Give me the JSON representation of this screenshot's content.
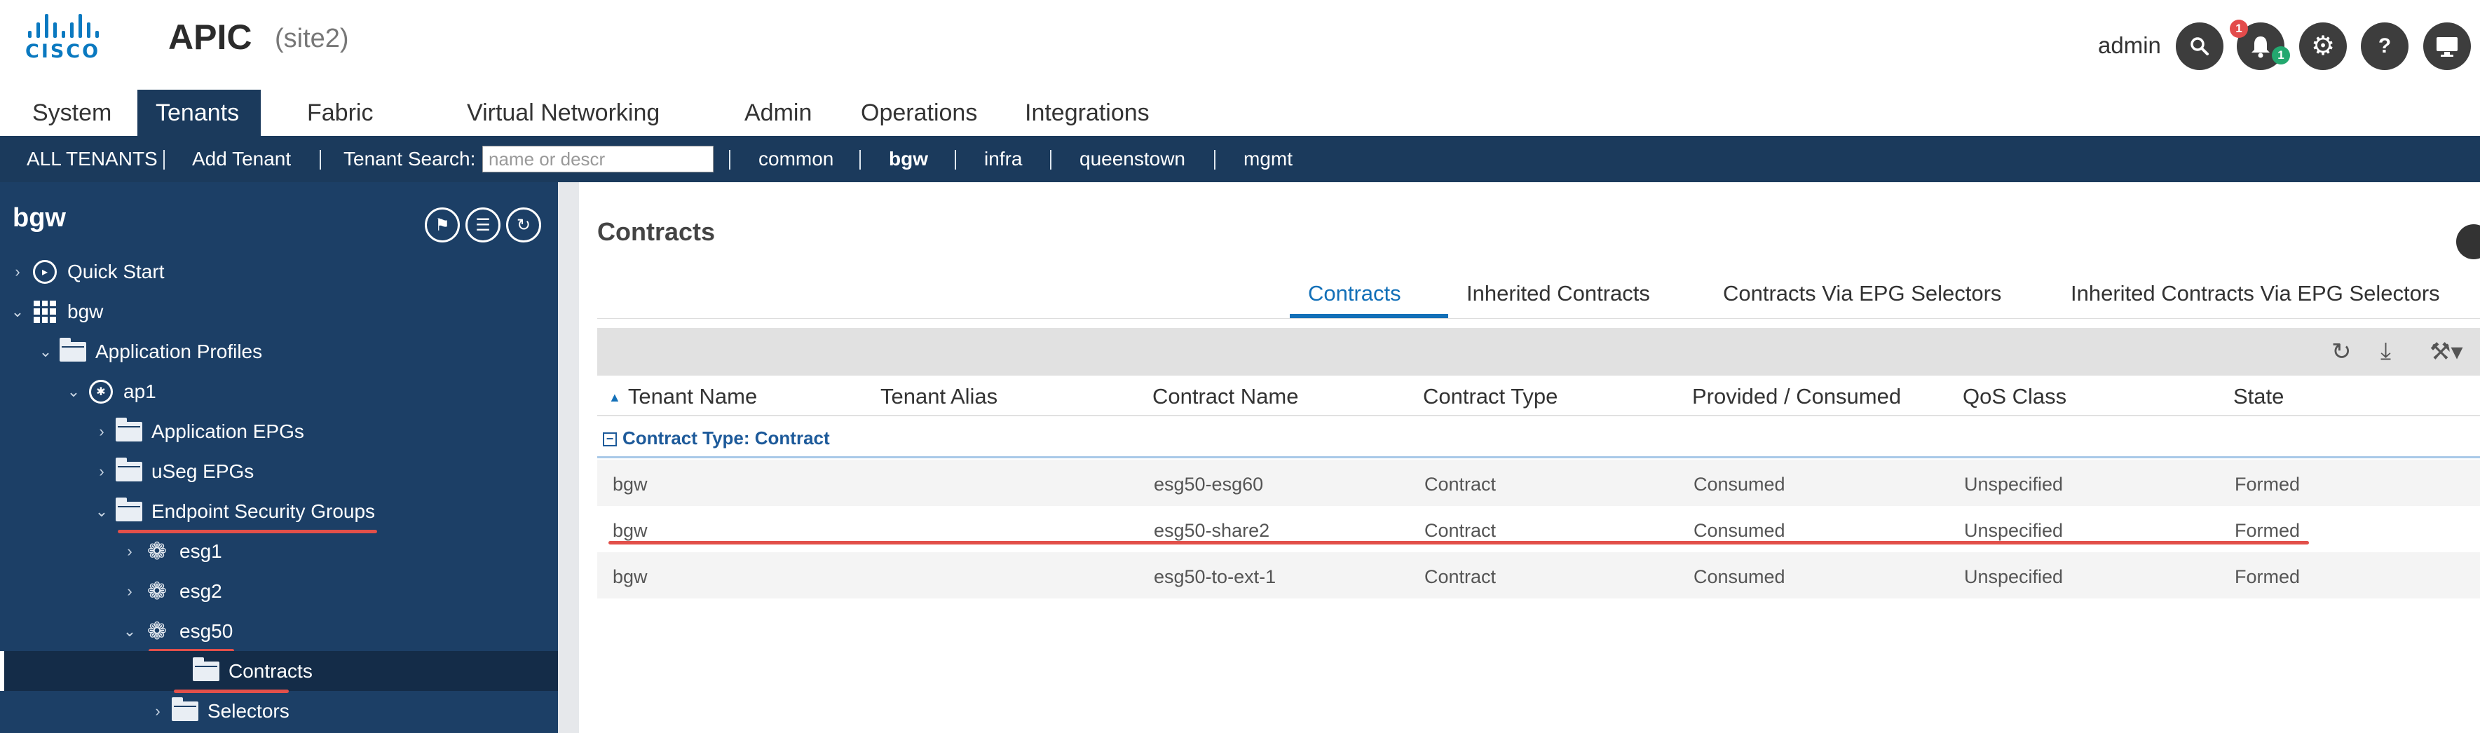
{
  "header": {
    "logo_text": "CISCO",
    "app_name": "APIC",
    "site": "(site2)",
    "user": "admin",
    "alert_badge": "1",
    "faults_badge": "1",
    "help_label": "?"
  },
  "nav": {
    "tabs": [
      "System",
      "Tenants",
      "Fabric",
      "Virtual Networking",
      "Admin",
      "Operations",
      "Integrations"
    ],
    "active": "Tenants"
  },
  "subbar": {
    "all_tenants": "ALL TENANTS",
    "add_tenant": "Add Tenant",
    "search_label": "Tenant Search:",
    "search_placeholder": "name or descr",
    "tenants": [
      "common",
      "bgw",
      "infra",
      "queenstown",
      "mgmt"
    ],
    "current": "bgw"
  },
  "sidebar": {
    "title": "bgw",
    "tree": [
      {
        "label": "Quick Start",
        "icon": "quick-start-icon"
      },
      {
        "label": "bgw",
        "icon": "tenant-grid-icon"
      },
      {
        "label": "Application Profiles",
        "icon": "folder-icon"
      },
      {
        "label": "ap1",
        "icon": "app-profile-icon"
      },
      {
        "label": "Application EPGs",
        "icon": "folder-icon"
      },
      {
        "label": "uSeg EPGs",
        "icon": "folder-icon"
      },
      {
        "label": "Endpoint Security Groups",
        "icon": "folder-icon"
      },
      {
        "label": "esg1",
        "icon": "esg-icon"
      },
      {
        "label": "esg2",
        "icon": "esg-icon"
      },
      {
        "label": "esg50",
        "icon": "esg-icon"
      },
      {
        "label": "Contracts",
        "icon": "folder-icon"
      },
      {
        "label": "Selectors",
        "icon": "folder-icon"
      }
    ],
    "selected": "Contracts"
  },
  "main": {
    "title": "Contracts",
    "tabs": [
      "Contracts",
      "Inherited Contracts",
      "Contracts Via EPG Selectors",
      "Inherited Contracts Via EPG Selectors"
    ],
    "active_tab": "Contracts",
    "columns": [
      "Tenant Name",
      "Tenant Alias",
      "Contract Name",
      "Contract Type",
      "Provided / Consumed",
      "QoS Class",
      "State"
    ],
    "group_label": "Contract Type: Contract",
    "rows": [
      {
        "tenant": "bgw",
        "alias": "",
        "contract": "esg50-esg60",
        "type": "Contract",
        "role": "Consumed",
        "qos": "Unspecified",
        "state": "Formed"
      },
      {
        "tenant": "bgw",
        "alias": "",
        "contract": "esg50-share2",
        "type": "Contract",
        "role": "Consumed",
        "qos": "Unspecified",
        "state": "Formed"
      },
      {
        "tenant": "bgw",
        "alias": "",
        "contract": "esg50-to-ext-1",
        "type": "Contract",
        "role": "Consumed",
        "qos": "Unspecified",
        "state": "Formed"
      }
    ]
  },
  "colors": {
    "nav_dark": "#1b3a5c",
    "tree_bg": "#1c3f66",
    "accent": "#1370b8",
    "annotation_red": "#e2504a",
    "cisco_blue": "#0a79c0"
  }
}
